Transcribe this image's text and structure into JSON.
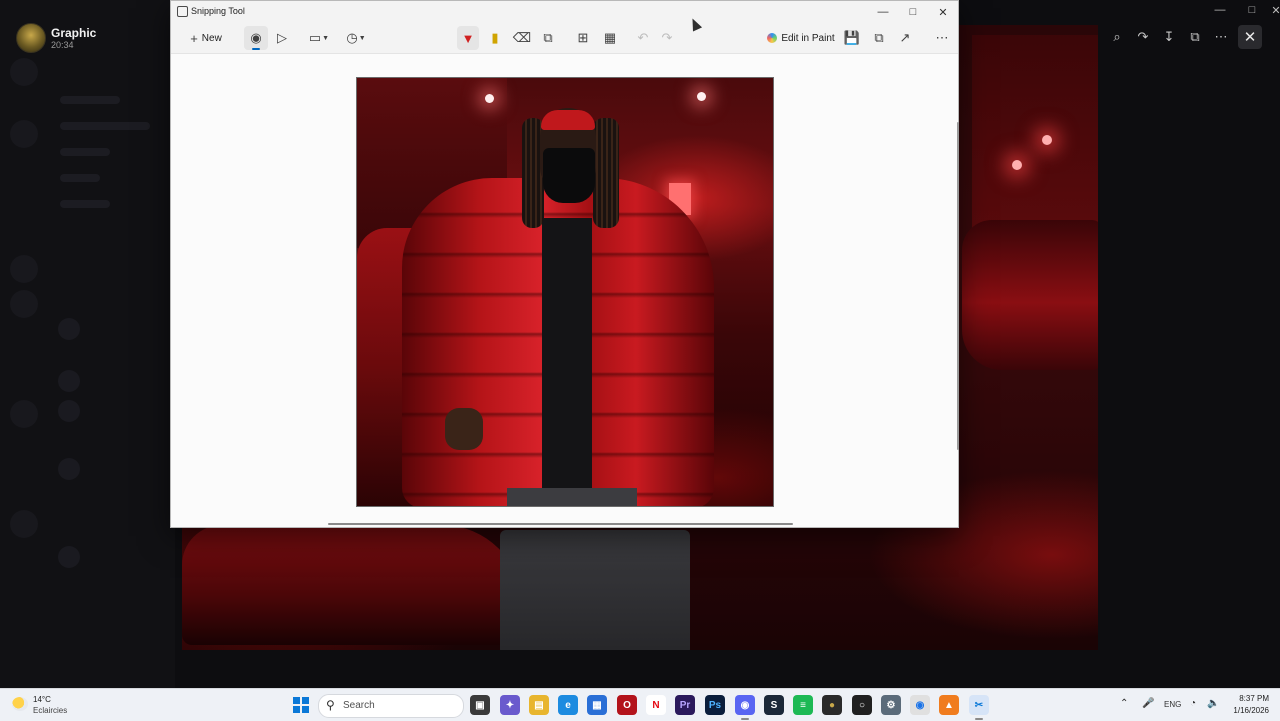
{
  "viewer": {
    "user_name": "Graphic",
    "user_time": "20:34"
  },
  "snipping_tool": {
    "title": "Snipping Tool",
    "new_label": "New",
    "edit_in_paint_label": "Edit in Paint",
    "colors": {
      "accent": "#0067c0",
      "pen": "#d02020",
      "highlighter": "#d0a400"
    }
  },
  "taskbar": {
    "weather_temp": "14°C",
    "weather_desc": "Eclaircies",
    "search_placeholder": "Search",
    "language": "ENG",
    "clock_time": "8:37 PM",
    "clock_date": "1/16/2026"
  }
}
